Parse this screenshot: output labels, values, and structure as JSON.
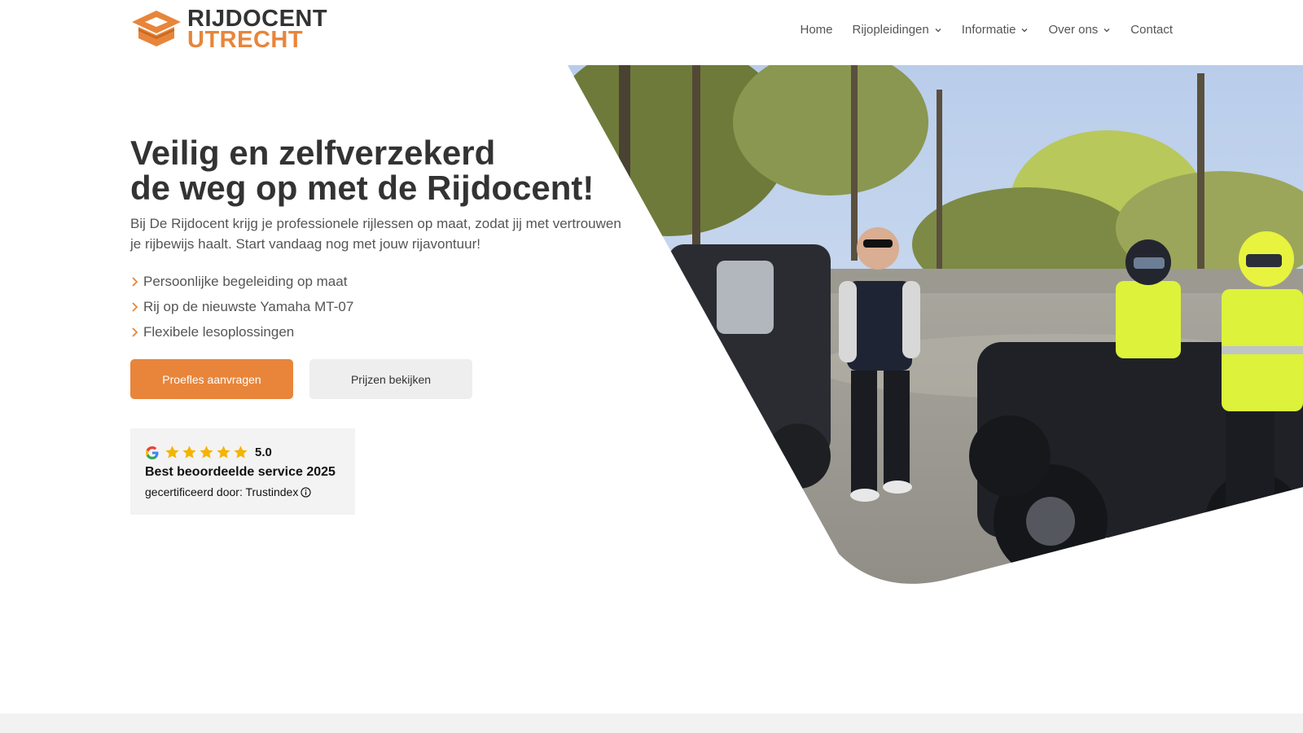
{
  "logo": {
    "line1": "RIJDOCENT",
    "line2": "UTRECHT",
    "icon": "graduation-cap-logo"
  },
  "nav": {
    "items": [
      {
        "label": "Home",
        "dropdown": false
      },
      {
        "label": "Rijopleidingen",
        "dropdown": true
      },
      {
        "label": "Informatie",
        "dropdown": true
      },
      {
        "label": "Over ons",
        "dropdown": true
      },
      {
        "label": "Contact",
        "dropdown": false
      }
    ]
  },
  "hero": {
    "title_line1": "Veilig en zelfverzekerd",
    "title_line2": "de weg op met de Rijdocent!",
    "subtitle": "Bij De Rijdocent krijg je professionele rijlessen op maat, zodat jij met vertrouwen je rijbewijs haalt. Start vandaag nog met jouw rijavontuur!",
    "bullets": [
      "Persoonlijke begeleiding op maat",
      "Rij op de nieuwste Yamaha MT-07",
      "Flexibele lesoplossingen"
    ],
    "primary_button": "Proefles aanvragen",
    "secondary_button": "Prijzen bekijken"
  },
  "trust_badge": {
    "rating": "5.0",
    "stars": 5,
    "title": "Best beoordeelde service 2025",
    "certified": "gecertificeerd door: Trustindex",
    "icons": [
      "google-icon",
      "star-icon",
      "info-icon"
    ]
  },
  "colors": {
    "accent": "#E8853A",
    "text_dark": "#333333",
    "text_muted": "#555555",
    "star": "#F5B400"
  }
}
